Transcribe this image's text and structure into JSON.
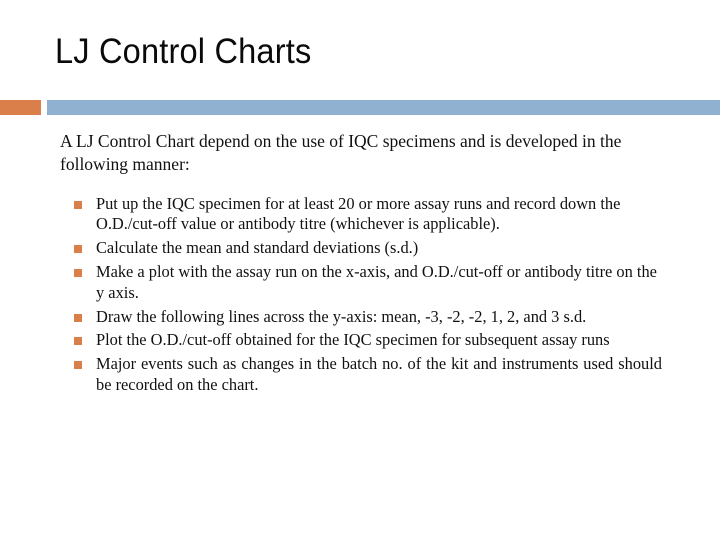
{
  "slide": {
    "title": "LJ Control Charts",
    "background_color": "#FFFFFF",
    "title_color": "#0A0A0A",
    "body_text_color": "#111111"
  },
  "divider": {
    "accent_block_color": "#DB7F4A",
    "bar_color": "#90B1D0"
  },
  "body": {
    "intro": "A LJ Control Chart depend on the use of IQC specimens and is developed in the following manner:",
    "bullet_marker_color": "#DB7F4A",
    "bullets": [
      {
        "text": "Put up the IQC specimen for at least 20 or more assay runs and record down the O.D./cut-off value or antibody titre (whichever is applicable).",
        "justified": false
      },
      {
        "text": "Calculate the mean and standard deviations (s.d.)",
        "justified": false
      },
      {
        "text": "Make a plot with the assay run on the x-axis, and O.D./cut-off or antibody titre on the y axis.",
        "justified": false
      },
      {
        "text": "Draw the following lines across the y-axis: mean, -3, -2, -2, 1, 2, and 3 s.d.",
        "justified": false
      },
      {
        "text": "Plot the O.D./cut-off obtained for the IQC specimen for subsequent assay runs",
        "justified": true
      },
      {
        "text": "Major events such as changes in the batch no. of the kit and instruments used should be recorded on the chart.",
        "justified": true
      }
    ]
  }
}
